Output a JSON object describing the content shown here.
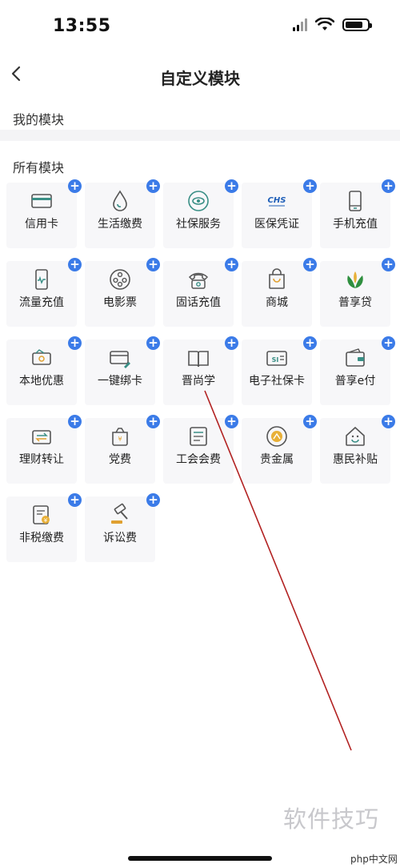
{
  "status_bar": {
    "time": "13:55"
  },
  "header": {
    "title": "自定义模块"
  },
  "my_modules": {
    "title": "我的模块"
  },
  "all_modules": {
    "title": "所有模块",
    "add_symbol": "+",
    "items": [
      {
        "label": "信用卡",
        "icon": "credit-card-icon"
      },
      {
        "label": "生活缴费",
        "icon": "water-drop-icon"
      },
      {
        "label": "社保服务",
        "icon": "eye-circle-icon"
      },
      {
        "label": "医保凭证",
        "icon": "chs-logo-icon"
      },
      {
        "label": "手机充值",
        "icon": "mobile-phone-icon"
      },
      {
        "label": "流量充值",
        "icon": "data-phone-icon"
      },
      {
        "label": "电影票",
        "icon": "film-reel-icon"
      },
      {
        "label": "固话充值",
        "icon": "telephone-icon"
      },
      {
        "label": "商城",
        "icon": "shopping-bag-icon"
      },
      {
        "label": "普享贷",
        "icon": "sprout-icon"
      },
      {
        "label": "本地优惠",
        "icon": "coupon-icon"
      },
      {
        "label": "一键绑卡",
        "icon": "bind-card-icon"
      },
      {
        "label": "晋尚学",
        "icon": "open-book-icon"
      },
      {
        "label": "电子社保卡",
        "icon": "social-security-card-icon"
      },
      {
        "label": "普享e付",
        "icon": "wallet-icon"
      },
      {
        "label": "理财转让",
        "icon": "transfer-icon"
      },
      {
        "label": "党费",
        "icon": "party-fee-icon"
      },
      {
        "label": "工会会费",
        "icon": "union-card-icon"
      },
      {
        "label": "贵金属",
        "icon": "gold-coin-icon"
      },
      {
        "label": "惠民补贴",
        "icon": "house-subsidy-icon"
      },
      {
        "label": "非税缴费",
        "icon": "tax-form-icon"
      },
      {
        "label": "诉讼费",
        "icon": "gavel-icon"
      }
    ]
  },
  "watermark": {
    "main": "软件技巧",
    "small": "php中文网"
  },
  "colors": {
    "badge": "#3b7be8",
    "icon_teal": "#3a8f86",
    "tile_bg": "#f7f7f9",
    "annotation": "#b22222"
  }
}
